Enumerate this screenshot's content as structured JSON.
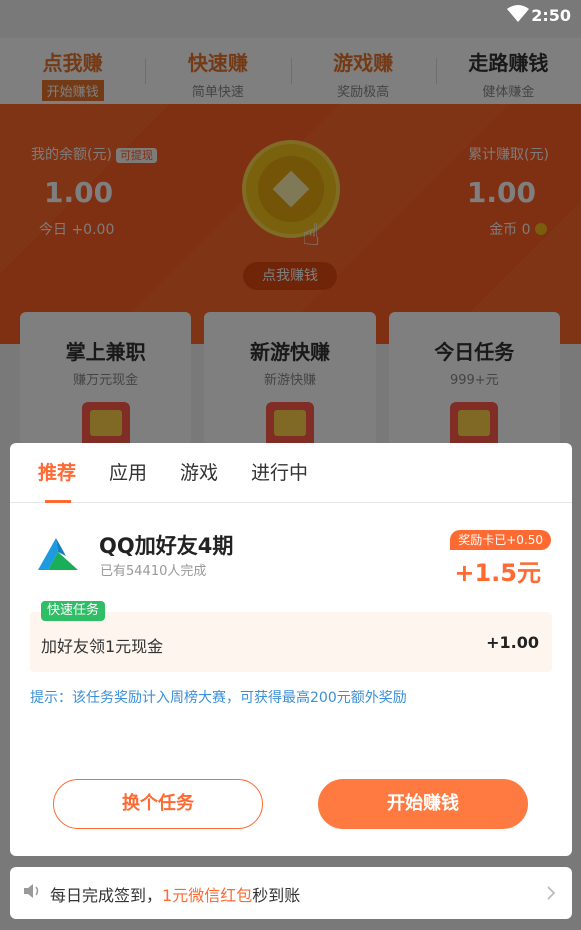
{
  "status": {
    "time": "2:50"
  },
  "top_tabs": [
    {
      "title": "点我赚",
      "subtitle": "开始赚钱"
    },
    {
      "title": "快速赚",
      "subtitle": "简单快速"
    },
    {
      "title": "游戏赚",
      "subtitle": "奖励极高"
    },
    {
      "title": "走路赚钱",
      "subtitle": "健体赚金"
    }
  ],
  "banner": {
    "balance_label": "我的余额(元)",
    "withdraw_tag": "可提现",
    "balance_value": "1.00",
    "today": "今日 +0.00",
    "total_label": "累计赚取(元)",
    "total_value": "1.00",
    "coins": "金币 0",
    "tap_label": "点我赚钱"
  },
  "cards": [
    {
      "title": "掌上兼职",
      "subtitle": "赚万元现金"
    },
    {
      "title": "新游快赚",
      "subtitle": "新游快赚"
    },
    {
      "title": "今日任务",
      "subtitle": "999+元"
    }
  ],
  "dialog": {
    "tabs": [
      "推荐",
      "应用",
      "游戏",
      "进行中"
    ],
    "task": {
      "title": "QQ加好友4期",
      "completed": "已有54410人完成",
      "reward_tag": "奖励卡已+0.50",
      "reward": "+1.5元"
    },
    "subtask": {
      "badge": "快速任务",
      "text": "加好友领1元现金",
      "value": "+1.00"
    },
    "hint": "提示：该任务奖励计入周榜大赛，可获得最高200元额外奖励",
    "swap_button": "换个任务",
    "start_button": "开始赚钱"
  },
  "notice": {
    "prefix": "每日完成签到，",
    "highlight": "1元微信红包",
    "suffix": "秒到账"
  },
  "colors": {
    "accent": "#ff6a33",
    "banner": "#ff5f24",
    "badge_green": "#2fbd66",
    "hint_blue": "#3b8fd8"
  }
}
